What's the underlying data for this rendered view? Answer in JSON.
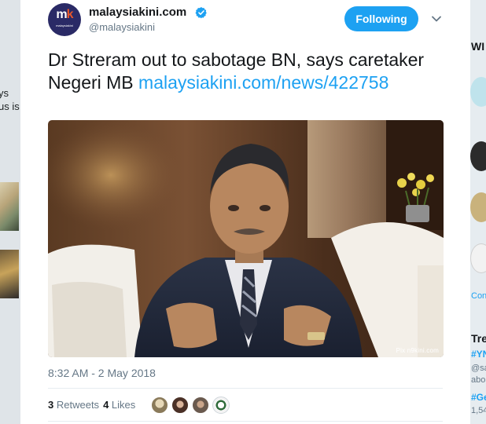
{
  "left_background": {
    "fragments": [
      "ys",
      "us is"
    ]
  },
  "right_background": {
    "header_fragment": "WI",
    "link_fragment": "Con",
    "trends_fragment": "Tre",
    "trend_items": [
      "#YN",
      "@sa",
      "abo",
      "#Ge",
      "1,54"
    ]
  },
  "tweet": {
    "author": {
      "display_name": "malaysiakini.com",
      "handle": "@malaysiakini",
      "avatar_logo_main": "m",
      "avatar_logo_accent": "k",
      "avatar_logo_sub": "malaysiakini",
      "verified": true
    },
    "follow_button": {
      "label": "Following",
      "color": "#1da1f2"
    },
    "text_plain": "Dr Streram out to sabotage BN, says caretaker Negeri MB ",
    "text_link": "malaysiakini.com/news/422758",
    "link_color": "#1da1f2",
    "photo": {
      "caption": "Pix n9kini.com"
    },
    "timestamp": "8:32 AM - 2 May 2018",
    "stats": {
      "retweets_count": "3",
      "retweets_label": "Retweets",
      "likes_count": "4",
      "likes_label": "Likes"
    },
    "liker_avatars": [
      "liker-avatar-1",
      "liker-avatar-2",
      "liker-avatar-3",
      "liker-avatar-4"
    ]
  }
}
